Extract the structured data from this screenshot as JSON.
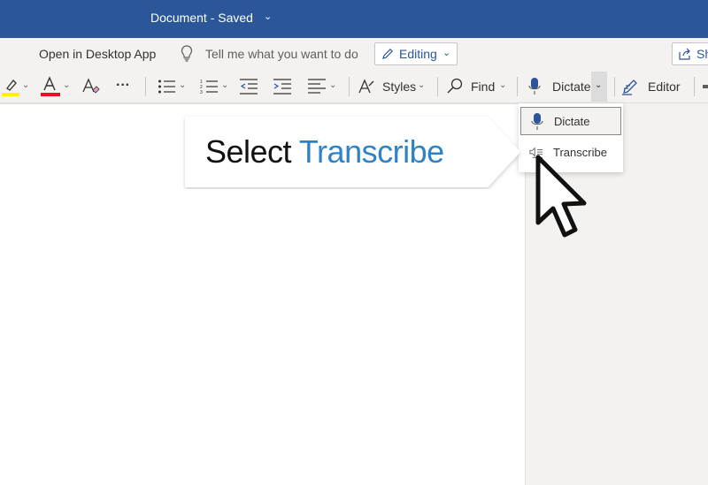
{
  "titlebar": {
    "title": "Document  -  Saved",
    "chevron": "⌄"
  },
  "command_bar": {
    "open_in_desktop_app": "Open in Desktop App",
    "tell_me_placeholder": "Tell me what you want to do",
    "editing_label": "Editing",
    "share_label": "Sh"
  },
  "ribbon": {
    "styles_label": "Styles",
    "find_label": "Find",
    "dictate_label": "Dictate",
    "editor_label": "Editor",
    "more_glyph": "···"
  },
  "dictate_menu": {
    "items": [
      {
        "label": "Dictate",
        "icon": "microphone-icon"
      },
      {
        "label": "Transcribe",
        "icon": "transcribe-icon"
      }
    ]
  },
  "callout": {
    "prefix": "Select ",
    "highlight": "Transcribe"
  },
  "colors": {
    "titlebar": "#2b579a",
    "accent_text": "#2e82c8",
    "highlight_yellow": "#fff100",
    "font_red": "#e81123",
    "mic_blue": "#2b579a"
  }
}
